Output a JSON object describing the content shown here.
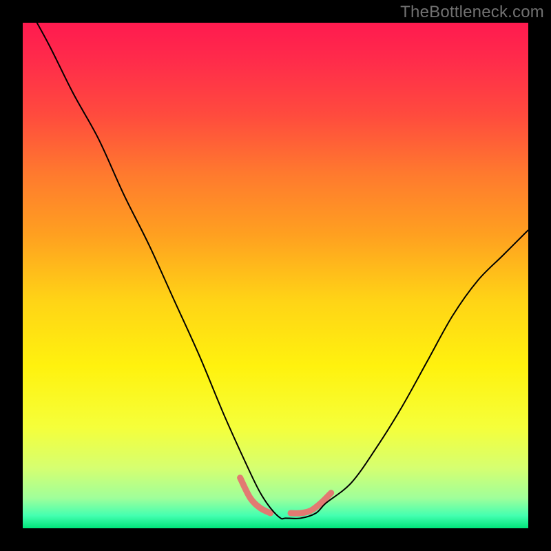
{
  "watermark": "TheBottleneck.com",
  "chart_data": {
    "type": "line",
    "title": "",
    "xlabel": "",
    "ylabel": "",
    "xlim": [
      0,
      100
    ],
    "ylim": [
      0,
      100
    ],
    "grid": false,
    "legend": false,
    "background": {
      "type": "vertical-gradient",
      "stops": [
        {
          "offset": 0.0,
          "color": "#ff1a4f"
        },
        {
          "offset": 0.08,
          "color": "#ff2d4a"
        },
        {
          "offset": 0.18,
          "color": "#ff4a3e"
        },
        {
          "offset": 0.3,
          "color": "#ff7a2e"
        },
        {
          "offset": 0.42,
          "color": "#ffa020"
        },
        {
          "offset": 0.55,
          "color": "#ffd416"
        },
        {
          "offset": 0.68,
          "color": "#fff20e"
        },
        {
          "offset": 0.8,
          "color": "#f5ff3a"
        },
        {
          "offset": 0.88,
          "color": "#d6ff70"
        },
        {
          "offset": 0.94,
          "color": "#a0ff9a"
        },
        {
          "offset": 0.975,
          "color": "#44ffb0"
        },
        {
          "offset": 1.0,
          "color": "#00e57a"
        }
      ]
    },
    "series": [
      {
        "name": "bottleneck-curve",
        "color": "#000000",
        "stroke_width": 2,
        "x": [
          0,
          5,
          10,
          15,
          20,
          25,
          30,
          35,
          40,
          45,
          47,
          49,
          51,
          52,
          55,
          58,
          60,
          65,
          70,
          75,
          80,
          85,
          90,
          95,
          100
        ],
        "y": [
          105,
          96,
          86,
          77,
          66,
          56,
          45,
          34,
          22,
          11,
          7,
          4,
          2,
          2,
          2,
          3,
          5,
          9,
          16,
          24,
          33,
          42,
          49,
          54,
          59
        ]
      }
    ],
    "marker_region": {
      "name": "optimal-range",
      "color": "#e27a72",
      "stroke_width": 9,
      "segments": [
        {
          "x": [
            43,
            45,
            47,
            49
          ],
          "y": [
            10,
            6,
            4,
            3
          ]
        },
        {
          "x": [
            53,
            55,
            57,
            59,
            61
          ],
          "y": [
            3,
            3,
            3.5,
            5,
            7
          ]
        }
      ]
    }
  }
}
